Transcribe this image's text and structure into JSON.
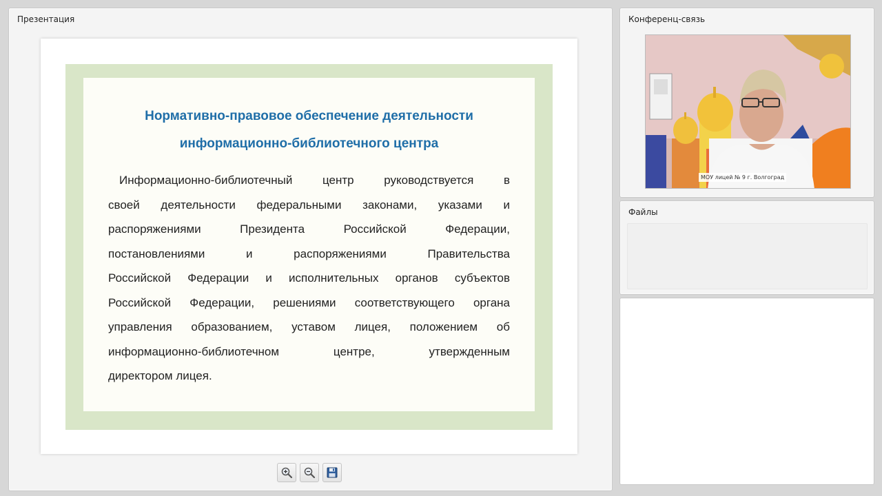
{
  "panels": {
    "presentation": {
      "title": "Презентация"
    },
    "conference": {
      "title": "Конференц-связь"
    },
    "files": {
      "title": "Файлы"
    }
  },
  "slide": {
    "title_lines": [
      "Нормативно-правовое обеспечение деятельности",
      "информационно-библиотечного центра"
    ],
    "body_lines": [
      "Информационно-библиотечный центр руководствуется в",
      "своей деятельности федеральными законами, указами и",
      "распоряжениями Президента Российской Федерации,",
      "постановлениями и распоряжениями Правительства",
      "Российской Федерации и исполнительных органов субъектов",
      "Российской Федерации, решениями соответствующего органа",
      "управления образованием, уставом лицея, положением об",
      "информационно-библиотечном центре, утвержденным",
      "директором лицея."
    ],
    "colors": {
      "title": "#1f6ea8",
      "border": "#d9e6c8",
      "background": "#fdfdf7"
    }
  },
  "toolbar": {
    "buttons": [
      {
        "icon": "zoom-in-icon"
      },
      {
        "icon": "zoom-out-icon"
      },
      {
        "icon": "save-icon"
      }
    ]
  },
  "video": {
    "caption": "МОУ лицей № 9 г. Волгоград"
  }
}
